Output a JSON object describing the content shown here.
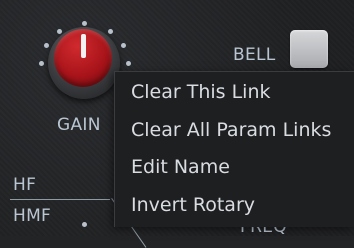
{
  "plugin": {
    "gain_label": "GAIN",
    "bell_label": "BELL",
    "hf_label": "HF",
    "hmf_label": "HMF",
    "freq_label": "FREQ",
    "knob_color": "#b81a20",
    "background": "#232426"
  },
  "context_menu": {
    "items": [
      {
        "label": "Clear This Link"
      },
      {
        "label": "Clear All Param Links"
      },
      {
        "label": "Edit Name"
      },
      {
        "label": "Invert Rotary"
      }
    ]
  }
}
